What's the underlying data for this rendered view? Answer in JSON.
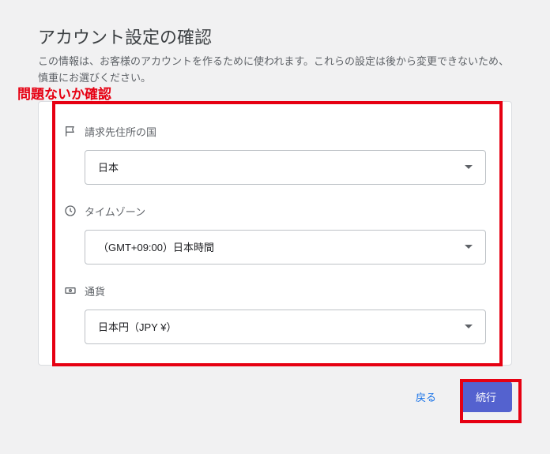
{
  "header": {
    "title": "アカウント設定の確認",
    "subtitle": "この情報は、お客様のアカウントを作るために使われます。これらの設定は後から変更できないため、慎重にお選びください。"
  },
  "annotation": "問題ないか確認",
  "fields": {
    "country": {
      "label": "請求先住所の国",
      "value": "日本"
    },
    "timezone": {
      "label": "タイムゾーン",
      "value": "（GMT+09:00）日本時間"
    },
    "currency": {
      "label": "通貨",
      "value": "日本円（JPY ¥）"
    }
  },
  "actions": {
    "back": "戻る",
    "continue": "続行"
  }
}
